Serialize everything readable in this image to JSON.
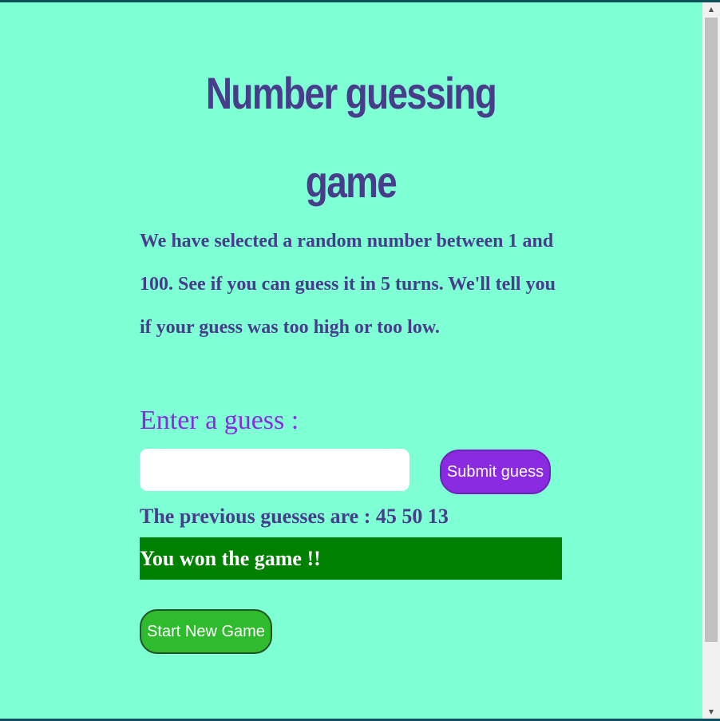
{
  "game": {
    "title": "Number guessing game",
    "intro": "We have selected a random number between 1 and 100. See if you can guess it in 5 turns. We'll tell you if your guess was too high or too low.",
    "guess_label": "Enter a guess :",
    "guess_value": "",
    "submit_label": "Submit guess",
    "previous_guesses": "The previous guesses are : 45 50 13",
    "result": "You won the game !!",
    "new_game_label": "Start New Game"
  },
  "scrollbar": {
    "up_arrow": "▲",
    "down_arrow": "▼"
  },
  "colors": {
    "page_background": "#7fffd4",
    "title_text": "#483d8b",
    "label_text": "#8a2be2",
    "submit_button": "#8a2be2",
    "result_background": "#008000",
    "new_game_button": "#2ebc2e"
  }
}
